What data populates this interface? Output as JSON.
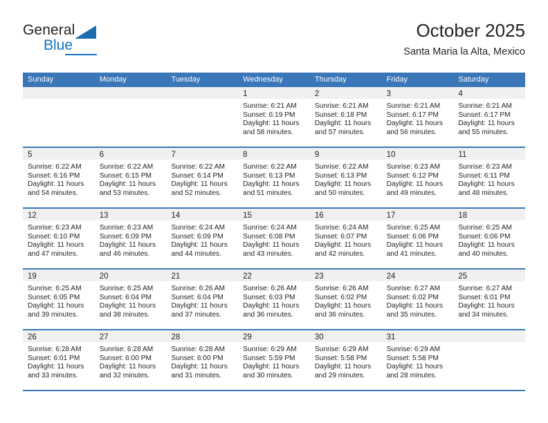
{
  "brand": {
    "name_top": "General",
    "name_bottom": "Blue",
    "accent_color": "#1271c0"
  },
  "header": {
    "title": "October 2025",
    "subtitle": "Santa Maria la Alta, Mexico"
  },
  "theme": {
    "header_bar_color": "#3a76b8",
    "daynum_band_color": "#f0f0f0",
    "text_color": "#231f20"
  },
  "weekdays": [
    "Sunday",
    "Monday",
    "Tuesday",
    "Wednesday",
    "Thursday",
    "Friday",
    "Saturday"
  ],
  "weeks": [
    [
      {
        "empty": true
      },
      {
        "empty": true
      },
      {
        "empty": true
      },
      {
        "day": "1",
        "sunrise": "Sunrise: 6:21 AM",
        "sunset": "Sunset: 6:19 PM",
        "daylight_1": "Daylight: 11 hours",
        "daylight_2": "and 58 minutes."
      },
      {
        "day": "2",
        "sunrise": "Sunrise: 6:21 AM",
        "sunset": "Sunset: 6:18 PM",
        "daylight_1": "Daylight: 11 hours",
        "daylight_2": "and 57 minutes."
      },
      {
        "day": "3",
        "sunrise": "Sunrise: 6:21 AM",
        "sunset": "Sunset: 6:17 PM",
        "daylight_1": "Daylight: 11 hours",
        "daylight_2": "and 56 minutes."
      },
      {
        "day": "4",
        "sunrise": "Sunrise: 6:21 AM",
        "sunset": "Sunset: 6:17 PM",
        "daylight_1": "Daylight: 11 hours",
        "daylight_2": "and 55 minutes."
      }
    ],
    [
      {
        "day": "5",
        "sunrise": "Sunrise: 6:22 AM",
        "sunset": "Sunset: 6:16 PM",
        "daylight_1": "Daylight: 11 hours",
        "daylight_2": "and 54 minutes."
      },
      {
        "day": "6",
        "sunrise": "Sunrise: 6:22 AM",
        "sunset": "Sunset: 6:15 PM",
        "daylight_1": "Daylight: 11 hours",
        "daylight_2": "and 53 minutes."
      },
      {
        "day": "7",
        "sunrise": "Sunrise: 6:22 AM",
        "sunset": "Sunset: 6:14 PM",
        "daylight_1": "Daylight: 11 hours",
        "daylight_2": "and 52 minutes."
      },
      {
        "day": "8",
        "sunrise": "Sunrise: 6:22 AM",
        "sunset": "Sunset: 6:13 PM",
        "daylight_1": "Daylight: 11 hours",
        "daylight_2": "and 51 minutes."
      },
      {
        "day": "9",
        "sunrise": "Sunrise: 6:22 AM",
        "sunset": "Sunset: 6:13 PM",
        "daylight_1": "Daylight: 11 hours",
        "daylight_2": "and 50 minutes."
      },
      {
        "day": "10",
        "sunrise": "Sunrise: 6:23 AM",
        "sunset": "Sunset: 6:12 PM",
        "daylight_1": "Daylight: 11 hours",
        "daylight_2": "and 49 minutes."
      },
      {
        "day": "11",
        "sunrise": "Sunrise: 6:23 AM",
        "sunset": "Sunset: 6:11 PM",
        "daylight_1": "Daylight: 11 hours",
        "daylight_2": "and 48 minutes."
      }
    ],
    [
      {
        "day": "12",
        "sunrise": "Sunrise: 6:23 AM",
        "sunset": "Sunset: 6:10 PM",
        "daylight_1": "Daylight: 11 hours",
        "daylight_2": "and 47 minutes."
      },
      {
        "day": "13",
        "sunrise": "Sunrise: 6:23 AM",
        "sunset": "Sunset: 6:09 PM",
        "daylight_1": "Daylight: 11 hours",
        "daylight_2": "and 46 minutes."
      },
      {
        "day": "14",
        "sunrise": "Sunrise: 6:24 AM",
        "sunset": "Sunset: 6:09 PM",
        "daylight_1": "Daylight: 11 hours",
        "daylight_2": "and 44 minutes."
      },
      {
        "day": "15",
        "sunrise": "Sunrise: 6:24 AM",
        "sunset": "Sunset: 6:08 PM",
        "daylight_1": "Daylight: 11 hours",
        "daylight_2": "and 43 minutes."
      },
      {
        "day": "16",
        "sunrise": "Sunrise: 6:24 AM",
        "sunset": "Sunset: 6:07 PM",
        "daylight_1": "Daylight: 11 hours",
        "daylight_2": "and 42 minutes."
      },
      {
        "day": "17",
        "sunrise": "Sunrise: 6:25 AM",
        "sunset": "Sunset: 6:06 PM",
        "daylight_1": "Daylight: 11 hours",
        "daylight_2": "and 41 minutes."
      },
      {
        "day": "18",
        "sunrise": "Sunrise: 6:25 AM",
        "sunset": "Sunset: 6:06 PM",
        "daylight_1": "Daylight: 11 hours",
        "daylight_2": "and 40 minutes."
      }
    ],
    [
      {
        "day": "19",
        "sunrise": "Sunrise: 6:25 AM",
        "sunset": "Sunset: 6:05 PM",
        "daylight_1": "Daylight: 11 hours",
        "daylight_2": "and 39 minutes."
      },
      {
        "day": "20",
        "sunrise": "Sunrise: 6:25 AM",
        "sunset": "Sunset: 6:04 PM",
        "daylight_1": "Daylight: 11 hours",
        "daylight_2": "and 38 minutes."
      },
      {
        "day": "21",
        "sunrise": "Sunrise: 6:26 AM",
        "sunset": "Sunset: 6:04 PM",
        "daylight_1": "Daylight: 11 hours",
        "daylight_2": "and 37 minutes."
      },
      {
        "day": "22",
        "sunrise": "Sunrise: 6:26 AM",
        "sunset": "Sunset: 6:03 PM",
        "daylight_1": "Daylight: 11 hours",
        "daylight_2": "and 36 minutes."
      },
      {
        "day": "23",
        "sunrise": "Sunrise: 6:26 AM",
        "sunset": "Sunset: 6:02 PM",
        "daylight_1": "Daylight: 11 hours",
        "daylight_2": "and 36 minutes."
      },
      {
        "day": "24",
        "sunrise": "Sunrise: 6:27 AM",
        "sunset": "Sunset: 6:02 PM",
        "daylight_1": "Daylight: 11 hours",
        "daylight_2": "and 35 minutes."
      },
      {
        "day": "25",
        "sunrise": "Sunrise: 6:27 AM",
        "sunset": "Sunset: 6:01 PM",
        "daylight_1": "Daylight: 11 hours",
        "daylight_2": "and 34 minutes."
      }
    ],
    [
      {
        "day": "26",
        "sunrise": "Sunrise: 6:28 AM",
        "sunset": "Sunset: 6:01 PM",
        "daylight_1": "Daylight: 11 hours",
        "daylight_2": "and 33 minutes."
      },
      {
        "day": "27",
        "sunrise": "Sunrise: 6:28 AM",
        "sunset": "Sunset: 6:00 PM",
        "daylight_1": "Daylight: 11 hours",
        "daylight_2": "and 32 minutes."
      },
      {
        "day": "28",
        "sunrise": "Sunrise: 6:28 AM",
        "sunset": "Sunset: 6:00 PM",
        "daylight_1": "Daylight: 11 hours",
        "daylight_2": "and 31 minutes."
      },
      {
        "day": "29",
        "sunrise": "Sunrise: 6:29 AM",
        "sunset": "Sunset: 5:59 PM",
        "daylight_1": "Daylight: 11 hours",
        "daylight_2": "and 30 minutes."
      },
      {
        "day": "30",
        "sunrise": "Sunrise: 6:29 AM",
        "sunset": "Sunset: 5:58 PM",
        "daylight_1": "Daylight: 11 hours",
        "daylight_2": "and 29 minutes."
      },
      {
        "day": "31",
        "sunrise": "Sunrise: 6:29 AM",
        "sunset": "Sunset: 5:58 PM",
        "daylight_1": "Daylight: 11 hours",
        "daylight_2": "and 28 minutes."
      },
      {
        "empty": true
      }
    ]
  ]
}
